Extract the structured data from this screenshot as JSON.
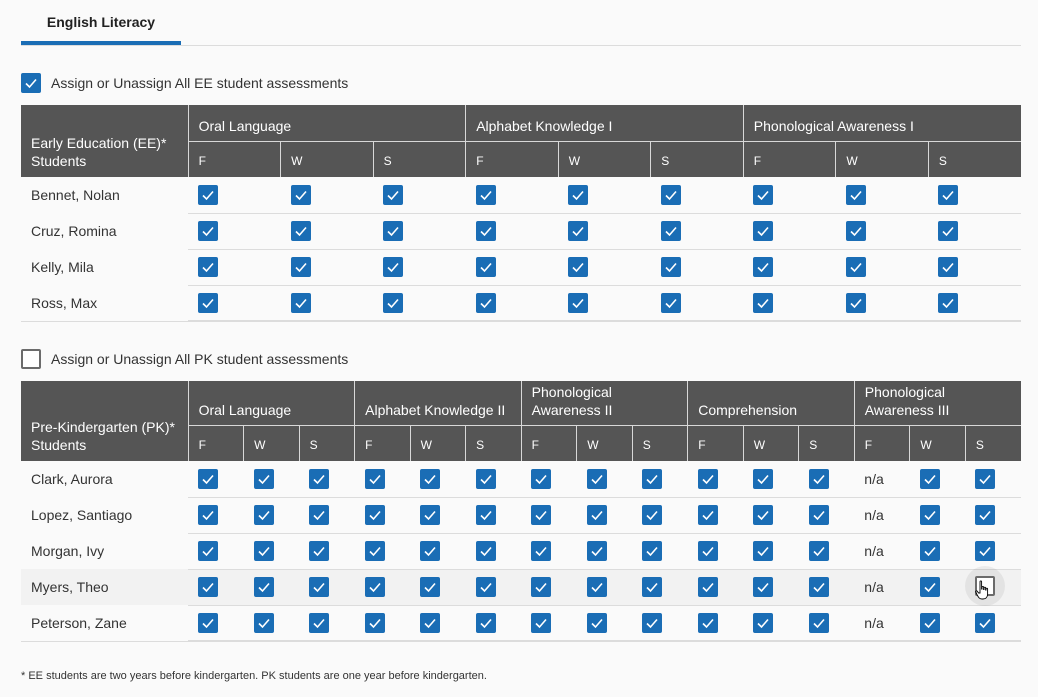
{
  "tabs": [
    {
      "label": "English Literacy",
      "active": true
    }
  ],
  "colors": {
    "accent": "#1a6db5",
    "header_bg": "#555555"
  },
  "ee": {
    "assign_all_label": "Assign or Unassign All EE student assessments",
    "assign_all_checked": true,
    "corner_header": "Early Education (EE)* Students",
    "groups": [
      "Oral Language",
      "Alphabet Knowledge I",
      "Phonological Awareness I"
    ],
    "sub_columns": [
      "F",
      "W",
      "S"
    ],
    "students": [
      {
        "name": "Bennet, Nolan",
        "values": [
          true,
          true,
          true,
          true,
          true,
          true,
          true,
          true,
          true
        ]
      },
      {
        "name": "Cruz, Romina",
        "values": [
          true,
          true,
          true,
          true,
          true,
          true,
          true,
          true,
          true
        ]
      },
      {
        "name": "Kelly, Mila",
        "values": [
          true,
          true,
          true,
          true,
          true,
          true,
          true,
          true,
          true
        ]
      },
      {
        "name": "Ross, Max",
        "values": [
          true,
          true,
          true,
          true,
          true,
          true,
          true,
          true,
          true
        ]
      }
    ]
  },
  "pk": {
    "assign_all_label": "Assign or Unassign All PK student assessments",
    "assign_all_checked": false,
    "corner_header": "Pre-Kindergarten (PK)* Students",
    "groups": [
      "Oral Language",
      "Alphabet Knowledge II",
      "Phonological Awareness II",
      "Comprehension",
      "Phonological Awareness III"
    ],
    "sub_columns": [
      "F",
      "W",
      "S"
    ],
    "na_label": "n/a",
    "students": [
      {
        "name": "Clark, Aurora",
        "values": [
          true,
          true,
          true,
          true,
          true,
          true,
          true,
          true,
          true,
          true,
          true,
          true,
          "n/a",
          true,
          true
        ]
      },
      {
        "name": "Lopez, Santiago",
        "values": [
          true,
          true,
          true,
          true,
          true,
          true,
          true,
          true,
          true,
          true,
          true,
          true,
          "n/a",
          true,
          true
        ]
      },
      {
        "name": "Morgan, Ivy",
        "values": [
          true,
          true,
          true,
          true,
          true,
          true,
          true,
          true,
          true,
          true,
          true,
          true,
          "n/a",
          true,
          true
        ]
      },
      {
        "name": "Myers, Theo",
        "hover": true,
        "values": [
          true,
          true,
          true,
          true,
          true,
          true,
          true,
          true,
          true,
          true,
          true,
          true,
          "n/a",
          true,
          false
        ]
      },
      {
        "name": "Peterson, Zane",
        "values": [
          true,
          true,
          true,
          true,
          true,
          true,
          true,
          true,
          true,
          true,
          true,
          true,
          "n/a",
          true,
          true
        ]
      }
    ]
  },
  "footnote": "* EE students are two years before kindergarten. PK students are one year before kindergarten."
}
